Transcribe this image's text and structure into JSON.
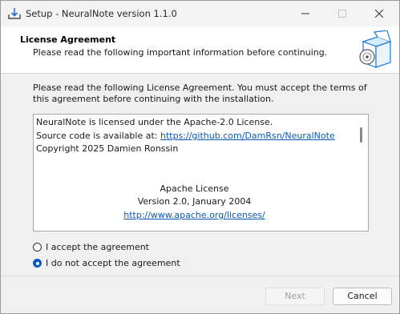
{
  "window": {
    "title": "Setup - NeuralNote version 1.1.0",
    "icon": "install-icon"
  },
  "header": {
    "title": "License Agreement",
    "subtitle": "Please read the following important information before continuing.",
    "image": "software-box-icon"
  },
  "intro": "Please read the following License Agreement. You must accept the terms of this agreement before continuing with the installation.",
  "license": {
    "line1": "NeuralNote is licensed under the Apache-2.0 License.",
    "line2_prefix": "Source code is available at: ",
    "line2_link": "https://github.com/DamRsn/NeuralNote",
    "line3": "Copyright 2025 Damien Ronssin",
    "line4": "Apache License",
    "line5": "Version 2.0, January 2004",
    "line6_link": "http://www.apache.org/licenses/"
  },
  "agreement": {
    "accept_label": "I accept the agreement",
    "decline_label": "I do not accept the agreement",
    "selected": "decline"
  },
  "buttons": {
    "next": "Next",
    "cancel": "Cancel"
  },
  "colors": {
    "accent": "#0a58c4",
    "link": "#0a58b4"
  }
}
